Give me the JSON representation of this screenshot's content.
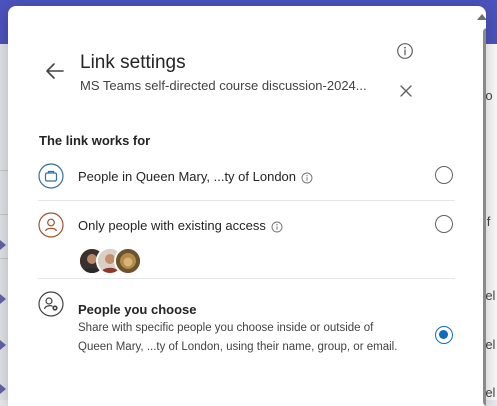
{
  "dialog": {
    "title": "Link settings",
    "subtitle": "MS Teams self-directed course discussion-2024...",
    "back_icon": "arrow-left-icon",
    "info_icon": "info-icon",
    "close_icon": "close-icon"
  },
  "section_heading": "The link works for",
  "options": [
    {
      "label": "People in Queen Mary, ...ty of London",
      "icon": "briefcase-icon",
      "has_info": true,
      "selected": false
    },
    {
      "label": "Only people with existing access",
      "icon": "person-circle-icon",
      "has_info": true,
      "selected": false,
      "avatars": [
        "avatar-1",
        "avatar-2",
        "avatar-3"
      ]
    },
    {
      "label": "People you choose",
      "icon": "people-settings-icon",
      "description": "Share with specific people you choose inside or outside of Queen Mary, ...ty of London, using their name, group, or email.",
      "selected": true
    }
  ],
  "background": {
    "right_fragments": [
      "ro",
      "lif",
      "rel",
      "rel",
      "rel"
    ]
  },
  "colors": {
    "accent": "#0f6cbd",
    "teams_purple": "#4b53bc",
    "icon_blue": "#2f6fa7",
    "icon_brown": "#a0522d"
  }
}
